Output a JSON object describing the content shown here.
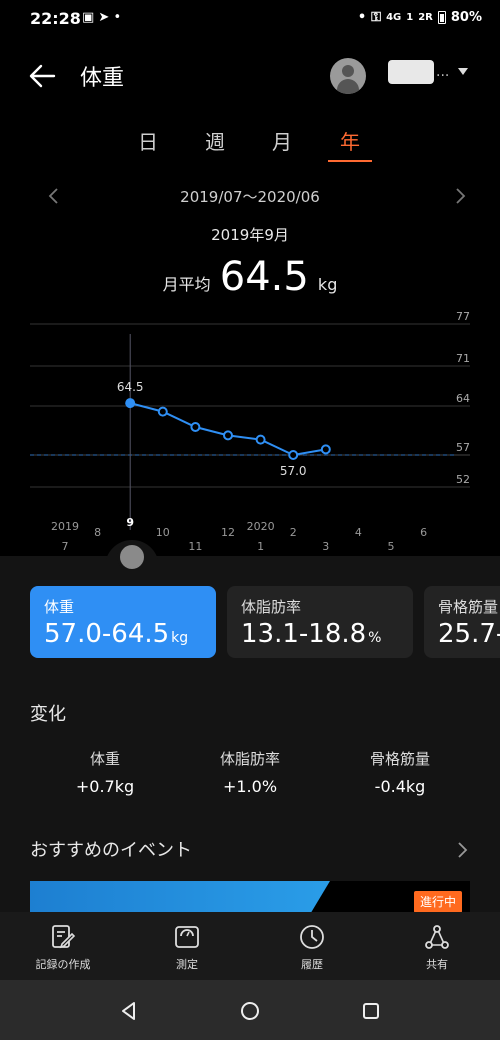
{
  "status_bar": {
    "time": "22:28",
    "network": "4G",
    "sim_badge": "1",
    "signal_label": "2R",
    "battery": "80%"
  },
  "header": {
    "title": "体重",
    "username_suffix": "..."
  },
  "tabs": [
    {
      "label": "日",
      "active": false
    },
    {
      "label": "週",
      "active": false
    },
    {
      "label": "月",
      "active": false
    },
    {
      "label": "年",
      "active": true
    }
  ],
  "period": {
    "range": "2019/07～2020/06",
    "selected": "2019年9月"
  },
  "summary": {
    "label": "月平均",
    "value": "64.5",
    "unit": "kg"
  },
  "chart_data": {
    "type": "line",
    "y_ticks": [
      "77",
      "71",
      "64",
      "57",
      "52"
    ],
    "ylim": [
      52,
      77
    ],
    "x_year_labels": [
      {
        "label": "2019",
        "month_index": 0
      },
      {
        "label": "2020",
        "month_index": 6
      }
    ],
    "x_months": [
      "7",
      "8",
      "9",
      "10",
      "11",
      "12",
      "1",
      "2",
      "3",
      "4",
      "5",
      "6"
    ],
    "x": [
      "2019-09",
      "2019-10",
      "2019-11",
      "2019-12",
      "2020-01",
      "2020-02",
      "2020-03"
    ],
    "values": [
      64.5,
      63.2,
      61.0,
      59.8,
      59.2,
      57.0,
      57.8
    ],
    "selected_index": 0,
    "selected_month_index": 2,
    "selected_label": "64.5",
    "min_label": "57.0",
    "min_index": 5,
    "reference_line": 57,
    "line_color": "#2f8ff4"
  },
  "cards": [
    {
      "label": "体重",
      "value": "57.0-64.5",
      "unit": "kg",
      "active": true
    },
    {
      "label": "体脂肪率",
      "value": "13.1-18.8",
      "unit": "%",
      "active": false
    },
    {
      "label": "骨格筋量",
      "value": "25.7-",
      "unit": "",
      "active": false
    }
  ],
  "change": {
    "title": "変化",
    "items": [
      {
        "label": "体重",
        "value": "+0.7",
        "unit": "kg"
      },
      {
        "label": "体脂肪率",
        "value": "+1.0%",
        "unit": ""
      },
      {
        "label": "骨格筋量",
        "value": "-0.4",
        "unit": "kg"
      }
    ]
  },
  "events": {
    "title": "おすすめのイベント",
    "badge": "進行中"
  },
  "bottom_nav": [
    {
      "label": "記録の作成",
      "icon": "edit-icon"
    },
    {
      "label": "測定",
      "icon": "scale-icon"
    },
    {
      "label": "履歴",
      "icon": "clock-icon"
    },
    {
      "label": "共有",
      "icon": "share-icon"
    }
  ],
  "colors": {
    "accent": "#ff6a32",
    "chart_line": "#2f8ff4",
    "card_active": "#2f8ff4",
    "badge": "#ff6a1f"
  }
}
